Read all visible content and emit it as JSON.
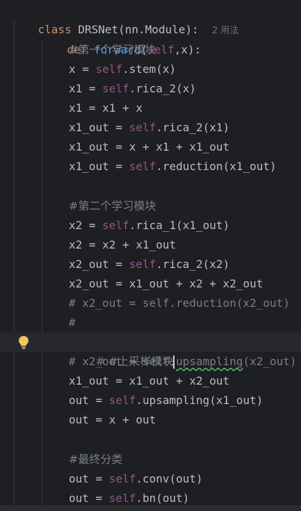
{
  "editor": {
    "class_line": {
      "keyword": "class",
      "name": "DRSNet(nn.Module):",
      "usages_hint": "2 用法"
    },
    "def_line": {
      "keyword": "def",
      "name": "forward",
      "params_open": "(",
      "self": "self",
      "params_rest": ",x):"
    },
    "block1": {
      "comment": "#第一个学习模块",
      "l1_pre": "x = ",
      "l1_self": "self",
      "l1_post": ".stem(x)",
      "l2_pre": "x1 = ",
      "l2_self": "self",
      "l2_post": ".rica_2(x)",
      "l3": "x1 = x1 + x",
      "l4_pre": "x1_out = ",
      "l4_self": "self",
      "l4_post": ".rica_2(x1)",
      "l5": "x1_out = x + x1 + x1_out",
      "l6_pre": "x1_out = ",
      "l6_self": "self",
      "l6_post": ".reduction(x1_out)"
    },
    "block2": {
      "comment": "#第二个学习模块",
      "l1_pre": "x2 = ",
      "l1_self": "self",
      "l1_post": ".rica_1(x1_out)",
      "l2": "x2 = x2 + x1_out",
      "l3_pre": "x2_out = ",
      "l3_self": "self",
      "l3_post": ".rica_2(x2)",
      "l4": "x2_out = x1_out + x2 + x2_out",
      "l5_comment": "# x2_out = self.reduction(x2_out)",
      "l6_comment": "#",
      "l7_comment": "# #上采样模块",
      "l8_comment_pre": "# x2_out = self.",
      "l8_comment_squiggle": "upsampling",
      "l8_comment_post": "(x2_out)",
      "l9": "x1_out = x1_out + x2_out",
      "l10_pre": "out = ",
      "l10_self": "self",
      "l10_post": ".upsampling(x1_out)",
      "l11": "out = x + out"
    },
    "block3": {
      "comment": "#最终分类",
      "l1_pre": "out = ",
      "l1_self": "self",
      "l1_post": ".conv(out)",
      "l2_pre": "out = ",
      "l2_self": "self",
      "l2_post": ".bn(out)"
    }
  },
  "colors": {
    "background": "#1e1f22",
    "keyword": "#cf8e6d",
    "function": "#56a8f5",
    "self": "#94558d",
    "comment": "#7a7e85",
    "text": "#bcbec4",
    "bulb": "#f2c55c"
  },
  "icons": {
    "intention_action": "lightbulb-icon"
  }
}
